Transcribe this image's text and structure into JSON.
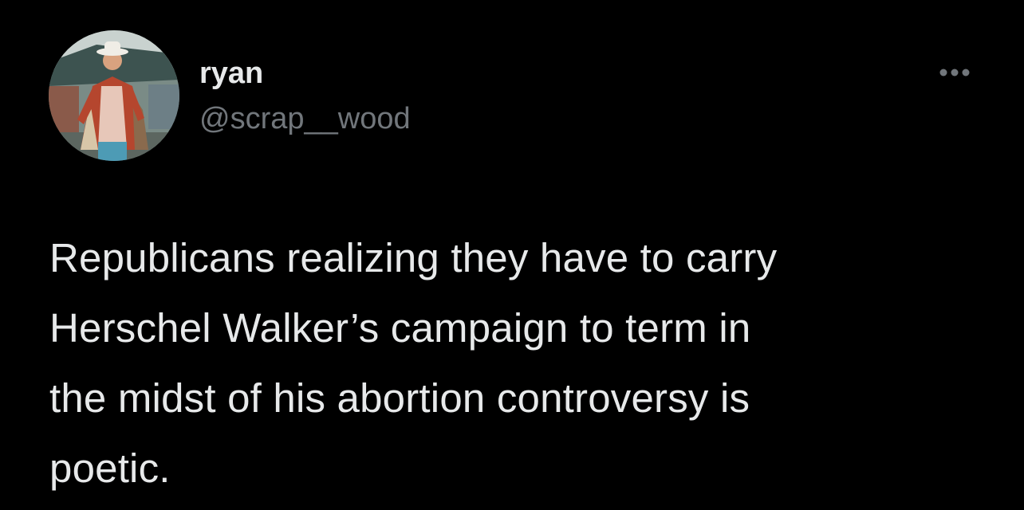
{
  "user": {
    "display_name": "ryan",
    "handle": "@scrap__wood",
    "avatar_icon": "profile-photo"
  },
  "menu": {
    "icon": "more-options-icon"
  },
  "tweet": {
    "lines": [
      "Republicans realizing they have to carry",
      "Herschel Walker’s campaign to term in",
      "the midst of his abortion controversy is",
      "poetic."
    ]
  },
  "colors": {
    "background": "#000000",
    "primary_text": "#e7e9ea",
    "secondary_text": "#71767b"
  }
}
